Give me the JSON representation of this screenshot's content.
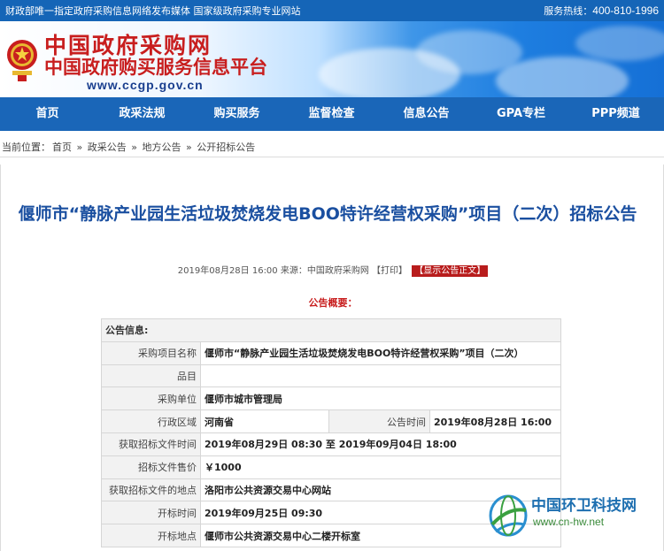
{
  "topbar": {
    "left": "财政部唯一指定政府采购信息网络发布媒体 国家级政府采购专业网站",
    "hotline_label": "服务热线：",
    "hotline_number": "400-810-1996"
  },
  "header": {
    "site_name": "中国政府采购网",
    "site_subtitle": "中国政府购买服务信息平台",
    "site_url": "www.ccgp.gov.cn"
  },
  "nav": {
    "items": [
      "首页",
      "政采法规",
      "购买服务",
      "监督检查",
      "信息公告",
      "GPA专栏",
      "PPP频道"
    ]
  },
  "breadcrumb": {
    "prefix": "当前位置：",
    "items": [
      "首页",
      "政采公告",
      "地方公告",
      "公开招标公告"
    ],
    "sep": "»"
  },
  "article": {
    "title": "偃师市“静脉产业园生活垃圾焚烧发电BOO特许经营权采购”项目（二次）招标公告",
    "meta_date": "2019年08月28日 16:00",
    "meta_source": "来源：中国政府采购网",
    "print_label": "【打印】",
    "show_label": "【显示公告正文】",
    "summary_label": "公告概要："
  },
  "info_table": {
    "header": "公告信息:",
    "rows": {
      "project_name_label": "采购项目名称",
      "project_name": "偃师市“静脉产业园生活垃圾焚烧发电BOO特许经营权采购”项目（二次）",
      "item_label": "品目",
      "item": "",
      "buyer_label": "采购单位",
      "buyer": "偃师市城市管理局",
      "region_label": "行政区域",
      "region": "河南省",
      "pub_time_label": "公告时间",
      "pub_time": "2019年08月28日 16:00",
      "doc_time_label": "获取招标文件时间",
      "doc_time": "2019年08月29日 08:30 至 2019年09月04日 18:00",
      "price_label": "招标文件售价",
      "price": "￥1000",
      "doc_place_label": "获取招标文件的地点",
      "doc_place": "洛阳市公共资源交易中心网站",
      "open_time_label": "开标时间",
      "open_time": "2019年09月25日 09:30",
      "open_place_label": "开标地点",
      "open_place": "偃师市公共资源交易中心二楼开标室"
    }
  },
  "watermark": {
    "name": "中国环卫科技网",
    "url": "www.cn-hw.net"
  },
  "colors": {
    "brand_blue": "#1a66b8",
    "brand_red": "#c81e1e",
    "title_blue": "#1a4fa0"
  }
}
